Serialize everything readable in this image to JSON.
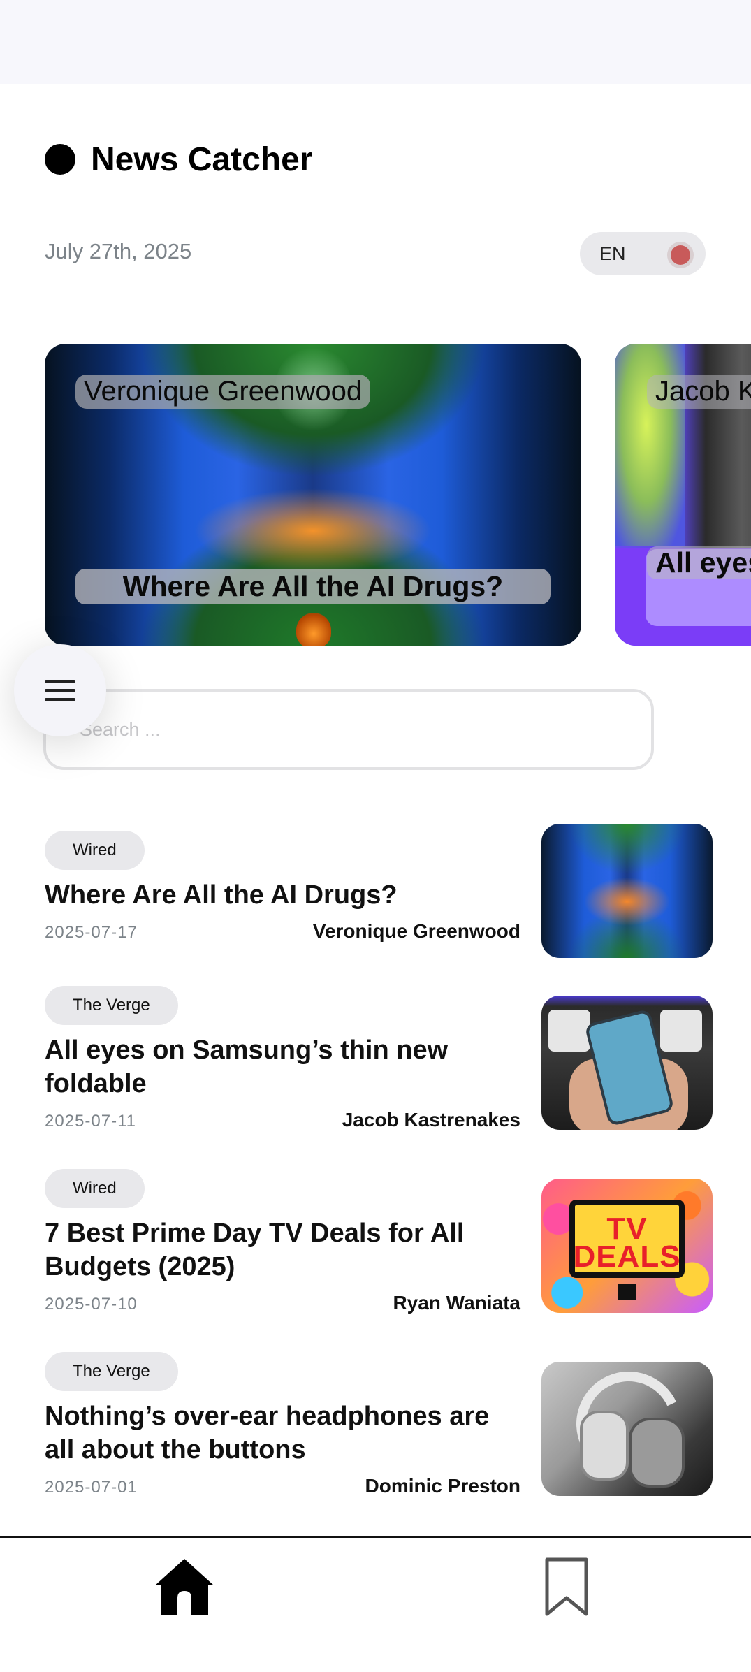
{
  "app": {
    "name": "News Catcher",
    "date": "July 27th, 2025",
    "language": "EN"
  },
  "carousel": [
    {
      "author": "Veronique Greenwood",
      "title": "Where Are All the AI Drugs?"
    },
    {
      "author": "Jacob Kastrenakes",
      "title": "All eyes on Samsung’s thin new foldable"
    }
  ],
  "search": {
    "placeholder": "Search ...",
    "value": ""
  },
  "news": [
    {
      "source": "Wired",
      "title": "Where Are All the AI Drugs?",
      "date": "2025-07-17",
      "author": "Veronique Greenwood",
      "image": "ai-drugs-thumbnail"
    },
    {
      "source": "The Verge",
      "title": "All eyes on Samsung’s thin new foldable",
      "date": "2025-07-11",
      "author": "Jacob Kastrenakes",
      "image": "samsung-foldable-thumbnail"
    },
    {
      "source": "Wired",
      "title": "7 Best Prime Day TV Deals for All Budgets (2025)",
      "date": "2025-07-10",
      "author": "Ryan Waniata",
      "image": "tv-deals-thumbnail",
      "image_text": "TV DEALS"
    },
    {
      "source": "The Verge",
      "title": "Nothing’s over-ear headphones are all about the buttons",
      "date": "2025-07-01",
      "author": "Dominic Preston",
      "image": "headphones-thumbnail"
    }
  ],
  "nav": {
    "items": [
      {
        "icon": "home-icon",
        "active": true
      },
      {
        "icon": "bookmark-icon",
        "active": false
      }
    ]
  },
  "colors": {
    "accent": "#000000",
    "toggle_knob": "#c85a5a",
    "muted_text": "#7c8389",
    "badge_bg": "#e8e8eb"
  }
}
